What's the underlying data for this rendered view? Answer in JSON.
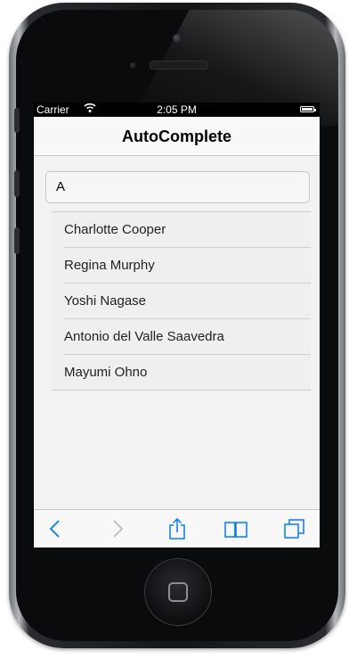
{
  "status_bar": {
    "carrier": "Carrier",
    "time": "2:05 PM"
  },
  "nav": {
    "title": "AutoComplete"
  },
  "search": {
    "value": "A"
  },
  "suggestions": [
    {
      "label": "Charlotte Cooper"
    },
    {
      "label": "Regina Murphy"
    },
    {
      "label": "Yoshi Nagase"
    },
    {
      "label": "Antonio del Valle Saavedra"
    },
    {
      "label": "Mayumi Ohno"
    }
  ],
  "toolbar": {
    "icons": [
      "back-icon",
      "forward-icon",
      "share-icon",
      "bookmarks-icon",
      "tabs-icon"
    ],
    "accent": "#007aff",
    "disabled": "#b8b8b8"
  }
}
